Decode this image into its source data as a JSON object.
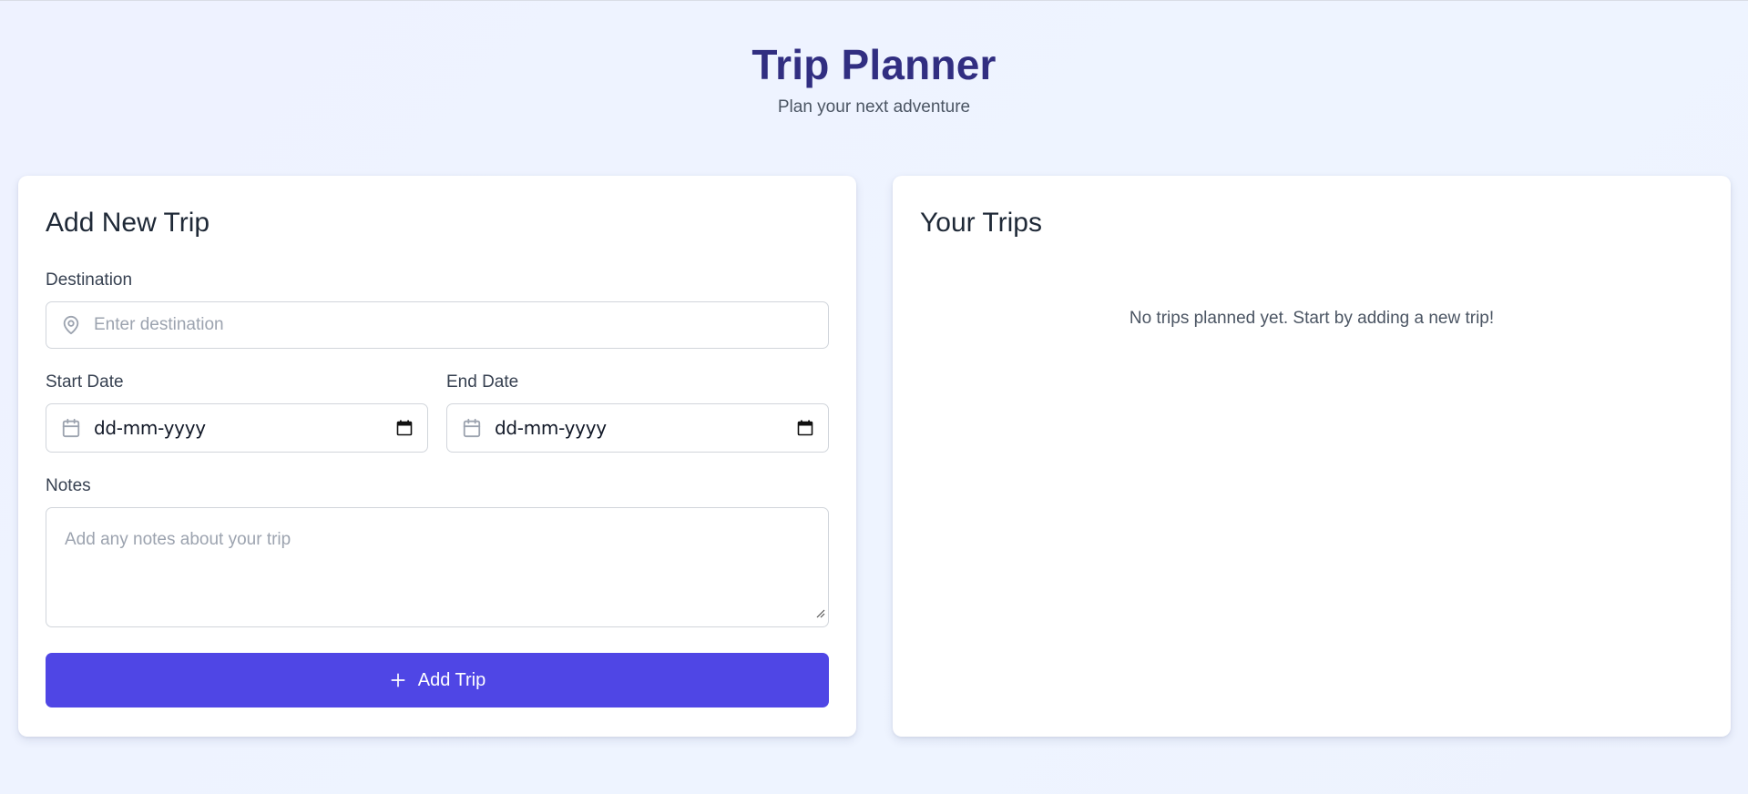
{
  "header": {
    "title": "Trip Planner",
    "subtitle": "Plan your next adventure"
  },
  "add_form": {
    "title": "Add New Trip",
    "destination": {
      "label": "Destination",
      "placeholder": "Enter destination",
      "value": ""
    },
    "start_date": {
      "label": "Start Date",
      "value": "dd-mm-yyyy"
    },
    "end_date": {
      "label": "End Date",
      "value": "dd-mm-yyyy"
    },
    "notes": {
      "label": "Notes",
      "placeholder": "Add any notes about your trip",
      "value": ""
    },
    "submit_label": "Add Trip"
  },
  "trips_panel": {
    "title": "Your Trips",
    "empty_message": "No trips planned yet. Start by adding a new trip!"
  },
  "colors": {
    "title": "#312e81",
    "accent": "#4f46e5",
    "background": "#eef2ff"
  },
  "icons": {
    "destination": "map-pin-icon",
    "date": "calendar-icon",
    "date_picker": "calendar-picker-icon",
    "add": "plus-icon"
  }
}
